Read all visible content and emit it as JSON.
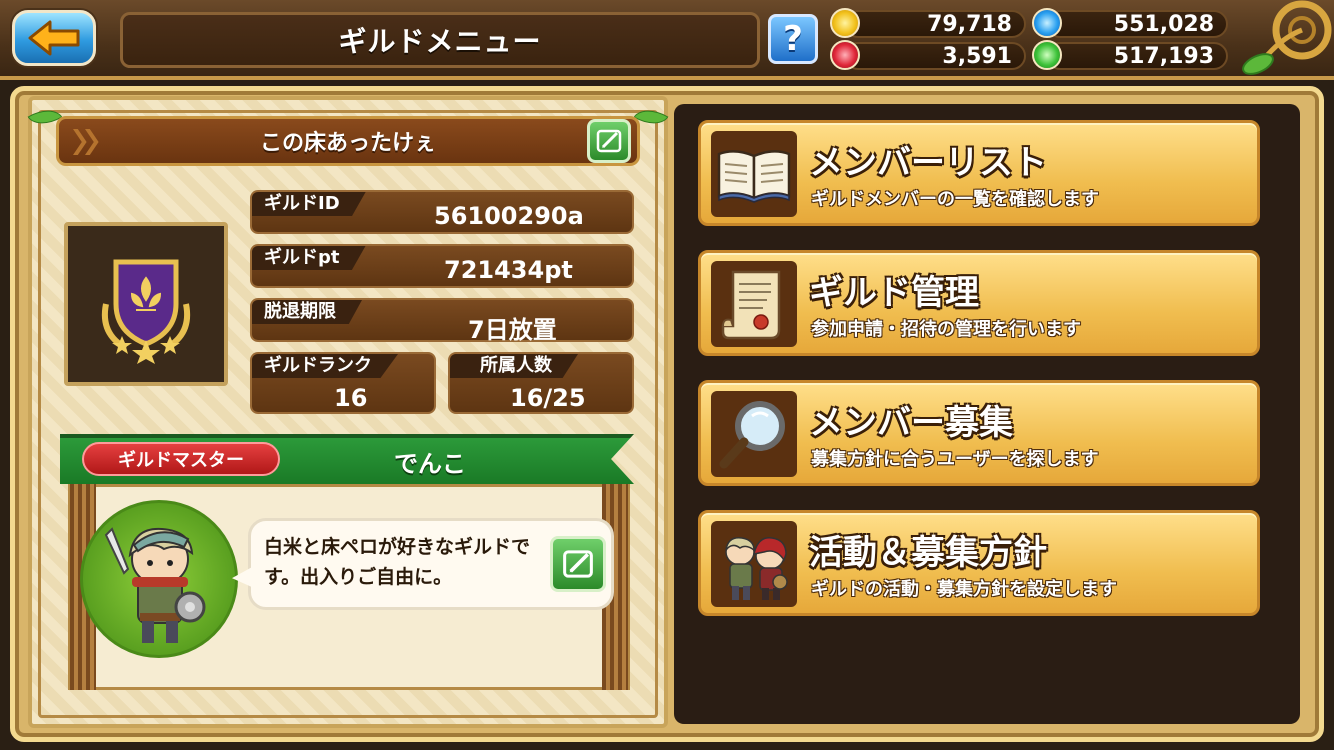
{
  "header": {
    "title": "ギルドメニュー",
    "help_label": "?"
  },
  "currencies": [
    {
      "name": "gold",
      "icon": "gold-coin-icon",
      "value": "79,718",
      "color": "#f2c21e"
    },
    {
      "name": "blue",
      "icon": "blue-crystal-icon",
      "value": "551,028",
      "color": "#2aa0f0"
    },
    {
      "name": "red",
      "icon": "red-orb-icon",
      "value": "3,591",
      "color": "#e0283a"
    },
    {
      "name": "green",
      "icon": "green-orb-icon",
      "value": "517,193",
      "color": "#3ec23a"
    }
  ],
  "guild": {
    "name": "この床あったけぇ",
    "id_label": "ギルドID",
    "id_value": "56100290a",
    "pt_label": "ギルドpt",
    "pt_value": "721434pt",
    "expire_label": "脱退期限",
    "expire_value": "7日放置",
    "rank_label": "ギルドランク",
    "rank_value": "16",
    "members_label": "所属人数",
    "members_value": "16/25"
  },
  "guild_master": {
    "badge": "ギルドマスター",
    "name": "でんこ",
    "message": "白米と床ペロが好きなギルドです。出入りご自由に。"
  },
  "menu": [
    {
      "title": "メンバーリスト",
      "desc": "ギルドメンバーの一覧を確認します",
      "icon": "book-icon"
    },
    {
      "title": "ギルド管理",
      "desc": "参加申請・招待の管理を行います",
      "icon": "scroll-icon"
    },
    {
      "title": "メンバー募集",
      "desc": "募集方針に合うユーザーを探します",
      "icon": "magnifier-icon"
    },
    {
      "title": "活動＆募集方針",
      "desc": "ギルドの活動・募集方針を設定します",
      "icon": "characters-icon"
    }
  ]
}
